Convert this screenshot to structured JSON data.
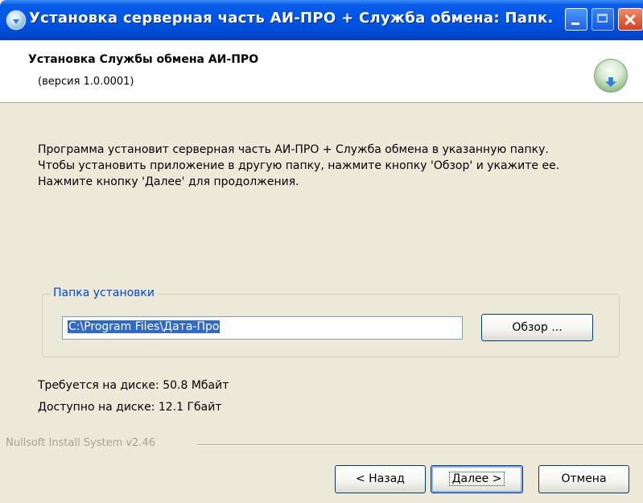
{
  "window": {
    "title": "Установка серверная часть АИ-ПРО + Служба обмена: Папк..."
  },
  "header": {
    "title": "Установка Службы обмена АИ-ПРО",
    "subtitle": "(версия 1.0.0001)"
  },
  "description": [
    "Программа установит серверная часть АИ-ПРО + Служба обмена в указанную папку.",
    "Чтобы установить приложение в другую папку, нажмите кнопку 'Обзор' и укажите ее.",
    "Нажмите кнопку 'Далее' для продолжения."
  ],
  "install_folder": {
    "group_label": "Папка установки",
    "path": "C:\\Program Files\\Дата-Про",
    "browse_label": "Обзор ..."
  },
  "disk": {
    "required": "Требуется на диске: 50.8 Мбайт",
    "available": "Доступно на диске: 12.1 Гбайт"
  },
  "branding": "Nullsoft Install System v2.46",
  "buttons": {
    "back": "< Назад",
    "next": "Далее >",
    "cancel": "Отмена"
  },
  "icons": {
    "title": "installer-globe-icon",
    "header": "install-download-icon"
  }
}
